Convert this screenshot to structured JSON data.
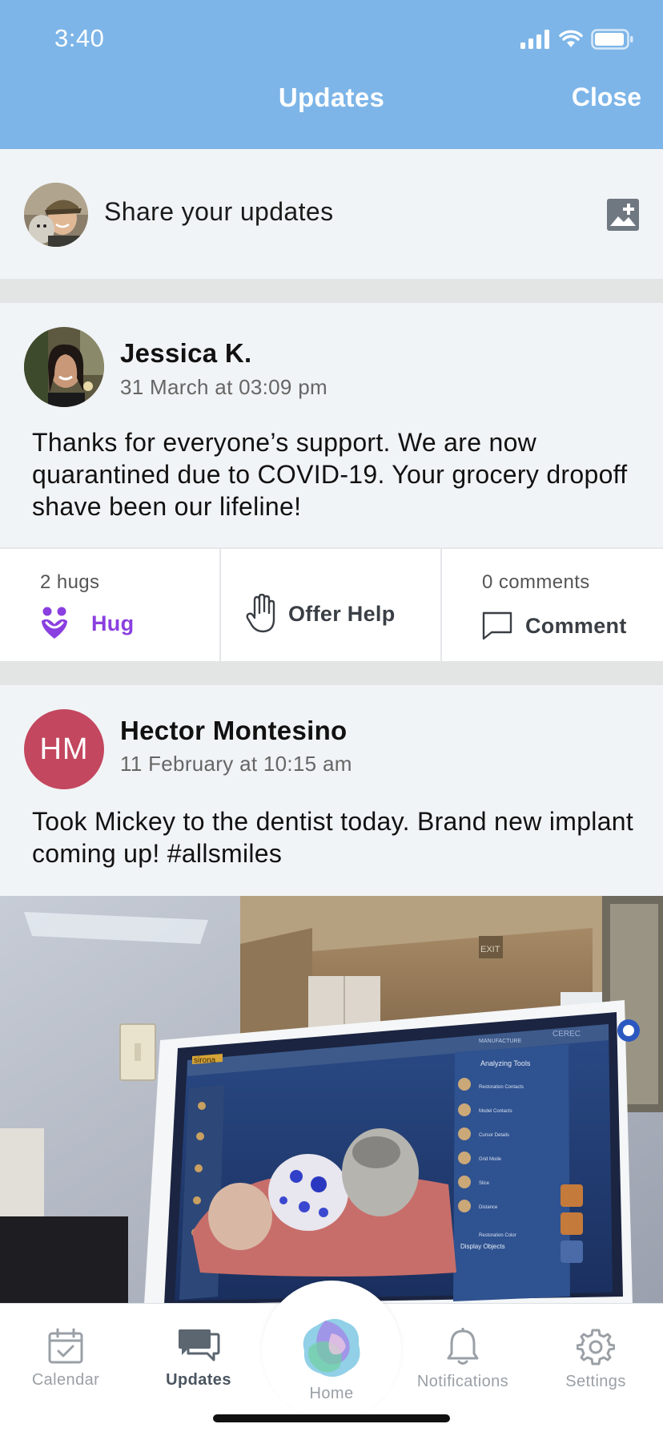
{
  "status_bar": {
    "time": "3:40"
  },
  "header": {
    "title": "Updates",
    "close_label": "Close"
  },
  "share": {
    "placeholder": "Share your updates",
    "add_photo_icon": "add-photo-icon"
  },
  "posts": [
    {
      "author": "Jessica K.",
      "time": "31 March at 03:09 pm",
      "body": "Thanks for everyone’s support. We are now quarantined due to COVID-19. Your grocery dropoff shave been our lifeline!",
      "hugs_count": "2 hugs",
      "hug_label": "Hug",
      "offer_help_label": "Offer Help",
      "comments_count": "0 comments",
      "comment_label": "Comment"
    },
    {
      "author": "Hector Montesino",
      "initials": "HM",
      "avatar_color": "#c3475f",
      "time": "11 February at 10:15 am",
      "body": "Took Mickey to the dentist today. Brand new implant coming up! #allsmiles",
      "photo_text": {
        "brand": "sirona",
        "exit_sign": "EXIT",
        "panel_title": "Analyzing Tools",
        "panel_items": [
          "Restoration Contacts",
          "Model Contacts",
          "Cursor Details",
          "Grid Mode",
          "Slice",
          "Distance",
          "Restoration Color"
        ],
        "display_objects": "Display Objects",
        "cerec": "CEREC",
        "manufacture": "MANUFACTURE"
      }
    }
  ],
  "tabbar": {
    "calendar": "Calendar",
    "updates": "Updates",
    "home": "Home",
    "notifications": "Notifications",
    "settings": "Settings"
  },
  "colors": {
    "header_bg": "#7db5e8",
    "hug_purple": "#8a3fe0",
    "page_bg": "#f1f4f6"
  }
}
